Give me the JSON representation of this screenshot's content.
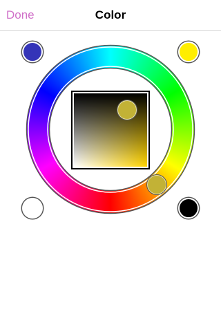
{
  "nav": {
    "done_label": "Done",
    "title": "Color"
  },
  "colors": {
    "accent": "#d070c8",
    "selected": "#c2b236",
    "hue": "#ffd400"
  },
  "presets": [
    {
      "name": "blue",
      "color": "#3434b8"
    },
    {
      "name": "yellow",
      "color": "#ffee00"
    },
    {
      "name": "white",
      "color": "#ffffff"
    },
    {
      "name": "black",
      "color": "#000000"
    }
  ],
  "picker": {
    "hue_degrees": 50,
    "saturation": 0.72,
    "brightness": 0.76
  }
}
